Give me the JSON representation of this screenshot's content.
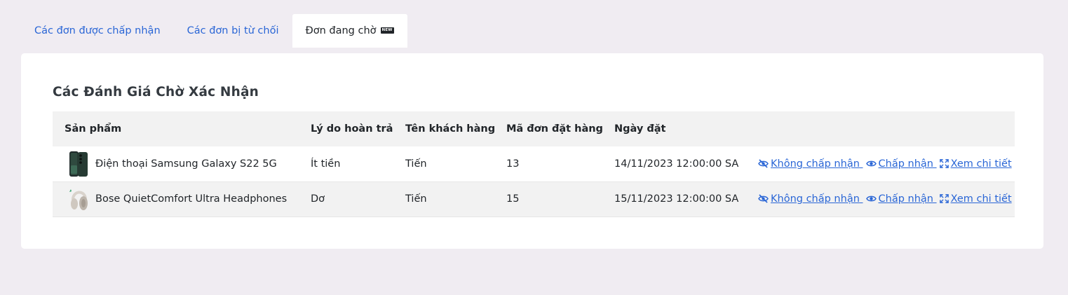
{
  "tabs": [
    {
      "label": "Các đơn được chấp nhận",
      "active": false
    },
    {
      "label": "Các đơn bị từ chối",
      "active": false
    },
    {
      "label": "Đơn đang chờ",
      "active": true,
      "badge": "NEW"
    }
  ],
  "card": {
    "title": "Các Đánh Giá Chờ Xác Nhận"
  },
  "table": {
    "headers": [
      "Sản phẩm",
      "Lý do hoàn trả",
      "Tên khách hàng",
      "Mã đơn đặt hàng",
      "Ngày đặt",
      ""
    ],
    "rows": [
      {
        "product": "Điện thoại Samsung Galaxy S22 5G",
        "thumb_icon": "phone-thumbnail",
        "reason": "Ít tiền",
        "customer": "Tiến",
        "order_id": "13",
        "date": "14/11/2023 12:00:00 SA"
      },
      {
        "product": "Bose QuietComfort Ultra Headphones",
        "thumb_icon": "headphones-thumbnail",
        "reason": "Dơ",
        "customer": "Tiến",
        "order_id": "15",
        "date": "15/11/2023 12:00:00 SA"
      }
    ],
    "actions": {
      "reject": "Không chấp nhận",
      "accept": "Chấp nhận",
      "details": "Xem chi tiết"
    }
  },
  "colors": {
    "link": "#2a66d6",
    "page_bg": "#f0ecf2",
    "header_bg": "#f2f2f2"
  }
}
